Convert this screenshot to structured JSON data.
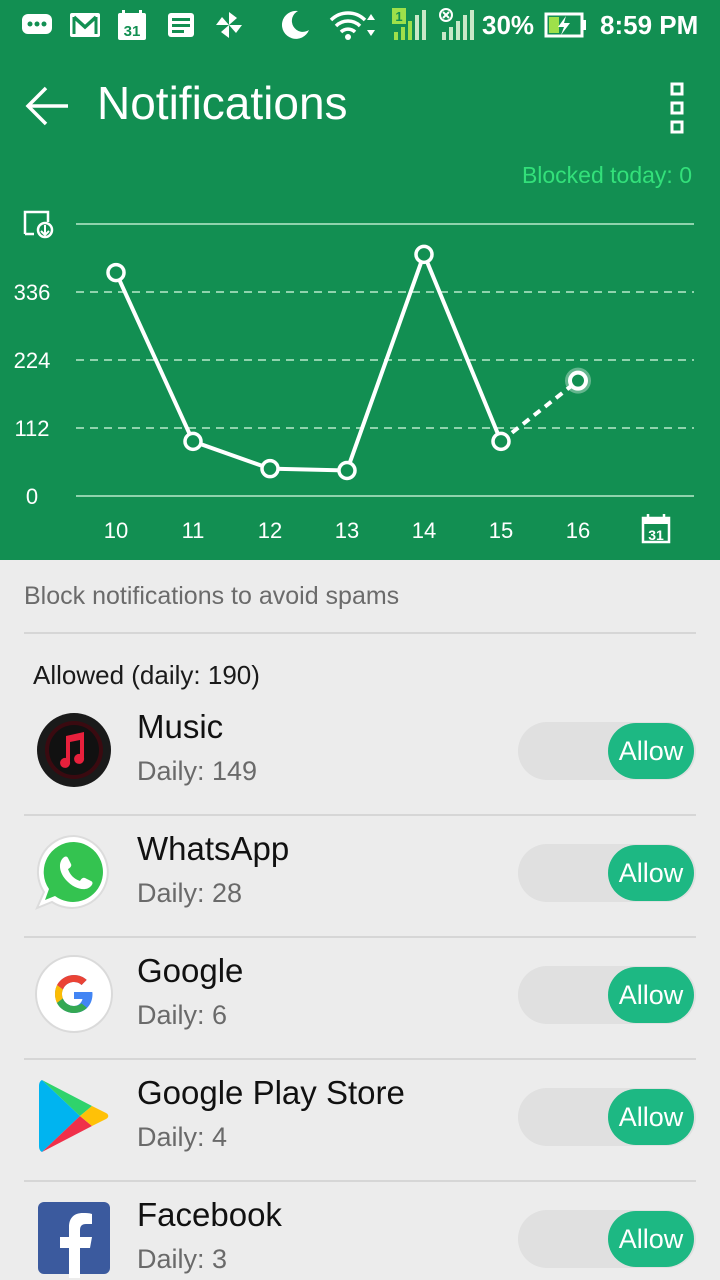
{
  "status_bar": {
    "battery": "30%",
    "time": "8:59 PM",
    "icons": [
      "chat-icon",
      "gmail-icon",
      "calendar-icon",
      "news-icon",
      "pinwheel-icon",
      "moon-icon",
      "wifi-icon",
      "signal-sim1-icon",
      "signal-sim2-icon",
      "battery-charging-icon"
    ],
    "calendar_date": "31"
  },
  "app_bar": {
    "title": "Notifications",
    "back_icon": "arrow-left-icon",
    "menu_icon": "more-vert-icon"
  },
  "blocked_today": "Blocked today: 0",
  "chart_data": {
    "type": "line",
    "categories": [
      "10",
      "11",
      "12",
      "13",
      "14",
      "15",
      "16"
    ],
    "values": [
      368,
      90,
      45,
      42,
      398,
      90,
      190
    ],
    "yticks": [
      "336",
      "224",
      "112",
      "0"
    ],
    "ylim": [
      0,
      448
    ],
    "grid": true,
    "last_segment_dashed": true,
    "line_color": "#ffffff",
    "calendar_icon": "calendar-icon",
    "calendar_date": "31",
    "export_icon": "export-download-icon"
  },
  "subtitle": "Block notifications to avoid spams",
  "section_label": "Allowed (daily: 190)",
  "apps": [
    {
      "name": "Music",
      "daily": "Daily: 149",
      "toggle": "Allow",
      "icon": "music-app-icon"
    },
    {
      "name": "WhatsApp",
      "daily": "Daily: 28",
      "toggle": "Allow",
      "icon": "whatsapp-icon"
    },
    {
      "name": "Google",
      "daily": "Daily: 6",
      "toggle": "Allow",
      "icon": "google-icon"
    },
    {
      "name": "Google Play Store",
      "daily": "Daily: 4",
      "toggle": "Allow",
      "icon": "play-store-icon"
    },
    {
      "name": "Facebook",
      "daily": "Daily: 3",
      "toggle": "Allow",
      "icon": "facebook-icon"
    }
  ],
  "colors": {
    "header_bg": "#128f52",
    "accent_text": "#33e07a",
    "toggle_on": "#1db883",
    "page_bg": "#ececec"
  }
}
